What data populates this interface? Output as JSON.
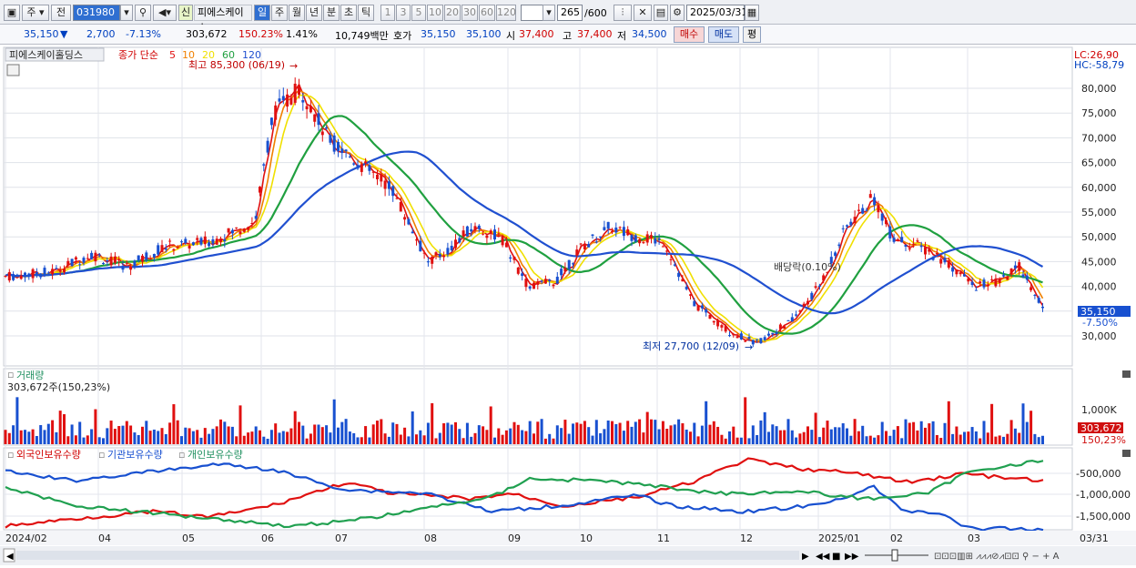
{
  "toolbar": {
    "market": "주",
    "prev": "전",
    "code": "031980",
    "badge": "신",
    "name": "피에스케이ㅎ",
    "periods": [
      "일",
      "주",
      "월",
      "년",
      "분",
      "초",
      "틱"
    ],
    "minutes": [
      "1",
      "3",
      "5",
      "10",
      "20",
      "30",
      "60",
      "120"
    ],
    "count": "265",
    "count_total": "/600",
    "date": "2025/03/31"
  },
  "quote": {
    "price": "35,150",
    "change": "2,700",
    "change_pct": "-7.13%",
    "volume": "303,672",
    "vol_ratio": "150.23%",
    "turnover_pct": "1.41%",
    "amount": "10,749백만",
    "hoga_label": "호가",
    "ask": "35,150",
    "bid": "35,100",
    "open_label": "시",
    "open": "37,400",
    "high_label": "고",
    "high": "37,400",
    "low_label": "저",
    "low": "34,500",
    "buy": "매수",
    "sell": "매도",
    "eval": "평"
  },
  "price_panel": {
    "stock_title": "피에스케이홀딩스",
    "ma_label": "종가 단순",
    "ma_periods": [
      "5",
      "10",
      "20",
      "60",
      "120"
    ],
    "ma_colors": [
      "#e01010",
      "#f08000",
      "#f0e000",
      "#20a040",
      "#2050d0"
    ],
    "lc": "LC:26,90",
    "hc": "HC:-58,79",
    "high_note": "최고 85,300 (06/19)",
    "low_note": "최저 27,700 (12/09)",
    "dividend_note": "배당락(0.10%)",
    "y_ticks": [
      "80,000",
      "75,000",
      "70,000",
      "65,000",
      "60,000",
      "55,000",
      "50,000",
      "45,000",
      "40,000",
      "35,000",
      "30,000"
    ],
    "last_price": "35,150",
    "last_pct": "-7.50%"
  },
  "volume_panel": {
    "title": "거래량",
    "info": "303,672주(150,23%)",
    "y_tick": "1,000K",
    "last_vol": "303,672",
    "last_pct": "150,23%"
  },
  "holding_panel": {
    "series": [
      "외국인보유수량",
      "기관보유수량",
      "개인보유수량"
    ],
    "y_ticks": [
      "-500,000",
      "-1,000,000",
      "-1,500,000"
    ]
  },
  "x_axis": {
    "labels": [
      "2024/02",
      "04",
      "05",
      "06",
      "07",
      "08",
      "09",
      "10",
      "11",
      "12",
      "2025/01",
      "02",
      "03"
    ],
    "right_label": "03/31"
  },
  "colors": {
    "up": "#e01010",
    "down": "#1850d0",
    "foreign": "#e01010",
    "inst": "#1850d0",
    "retail": "#20a050"
  }
}
